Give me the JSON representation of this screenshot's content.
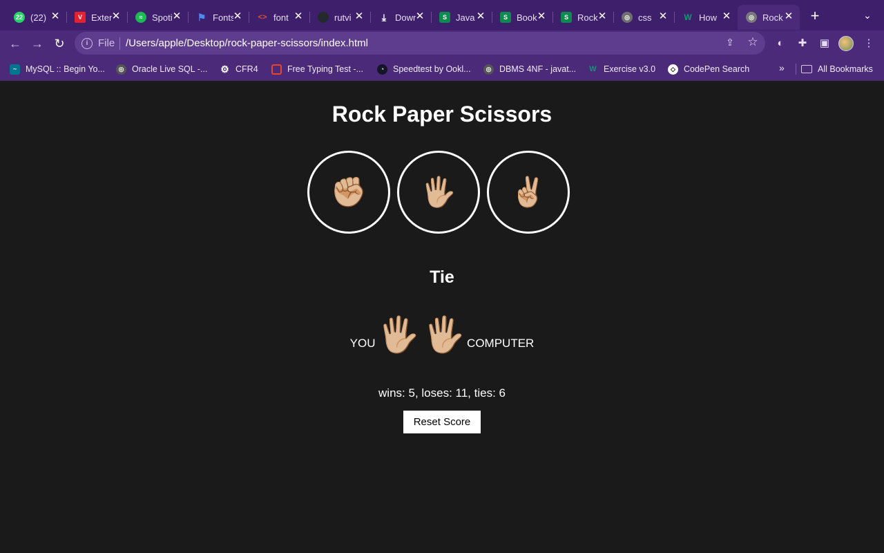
{
  "browser": {
    "tabs": [
      {
        "label": "(22)",
        "favicon": "whatsapp-icon",
        "color": "#25d366",
        "glyph": "22"
      },
      {
        "label": "Extensions",
        "favicon": "vivaldi-icon",
        "color": "#e6202e",
        "glyph": "V"
      },
      {
        "label": "Spotify",
        "favicon": "spotify-icon",
        "color": "#1db954",
        "glyph": "≈"
      },
      {
        "label": "Fonts",
        "favicon": "flag-icon",
        "color": "#4a8cf0",
        "glyph": "⚑"
      },
      {
        "label": "font",
        "favicon": "code-icon",
        "color": "#e2502d",
        "glyph": "<>"
      },
      {
        "label": "rutvi",
        "favicon": "github-icon",
        "color": "#24292e",
        "glyph": "●"
      },
      {
        "label": "Downloads",
        "favicon": "download-icon",
        "color": "#3e1f6b",
        "glyph": "⤓"
      },
      {
        "label": "Java",
        "favicon": "s-icon",
        "color": "#0d8a4e",
        "glyph": "S"
      },
      {
        "label": "Book",
        "favicon": "s-icon",
        "color": "#0d8a4e",
        "glyph": "S"
      },
      {
        "label": "Rock",
        "favicon": "s-icon",
        "color": "#0d8a4e",
        "glyph": "S"
      },
      {
        "label": "css",
        "favicon": "globe-icon",
        "color": "#6f6f6f",
        "glyph": "◎"
      },
      {
        "label": "How",
        "favicon": "w-icon",
        "color": "#0a9d6e",
        "glyph": "W"
      },
      {
        "label": "Rock",
        "favicon": "globe-icon",
        "color": "#7a7a7a",
        "glyph": "◎",
        "active": true
      }
    ],
    "address": {
      "scheme": "File",
      "url": "/Users/apple/Desktop/rock-paper-scissors/index.html"
    },
    "bookmarks": [
      {
        "label": "MySQL :: Begin Yo...",
        "icon": "mysql-icon",
        "color": "#00758f",
        "glyph": "🐬"
      },
      {
        "label": "Oracle Live SQL -...",
        "icon": "globe-icon",
        "color": "#555555",
        "glyph": "◎"
      },
      {
        "label": "CFR4",
        "icon": "gear-icon",
        "color": "#4b2a7a",
        "glyph": "⚙"
      },
      {
        "label": "Free Typing Test -...",
        "icon": "chat-icon",
        "color": "#e8452c",
        "glyph": "▢"
      },
      {
        "label": "Speedtest by Ookl...",
        "icon": "gauge-icon",
        "color": "#141526",
        "glyph": "◔"
      },
      {
        "label": "DBMS 4NF - javat...",
        "icon": "globe-icon",
        "color": "#555555",
        "glyph": "◎"
      },
      {
        "label": "Exercise v3.0",
        "icon": "w-icon",
        "color": "#0a9d6e",
        "glyph": "W"
      },
      {
        "label": "CodePen Search",
        "icon": "codepen-icon",
        "color": "#111111",
        "glyph": "◇"
      }
    ],
    "bookmarks_more": "»",
    "all_bookmarks": "All Bookmarks"
  },
  "game": {
    "title": "Rock Paper Scissors",
    "choices": [
      {
        "name": "rock",
        "emoji": "✊🏼"
      },
      {
        "name": "paper",
        "emoji": "🖐🏼"
      },
      {
        "name": "scissors",
        "emoji": "✌🏼"
      }
    ],
    "result": "Tie",
    "you_label": "YOU",
    "computer_label": "COMPUTER",
    "player_move": "🖐🏼",
    "computer_move": "🖐🏼",
    "score_text": "wins: 5, loses: 11, ties: 6",
    "reset_label": "Reset Score"
  }
}
